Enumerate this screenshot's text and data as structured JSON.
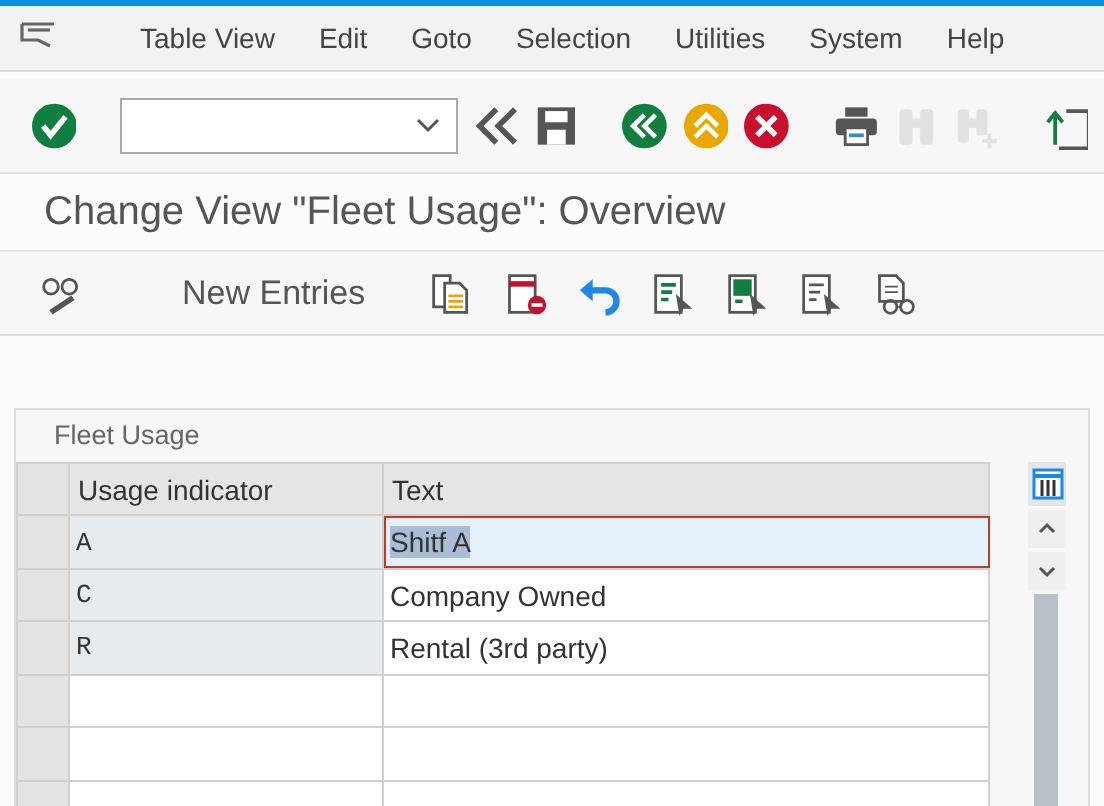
{
  "menu_bar": {
    "items": [
      "Table View",
      "Edit",
      "Goto",
      "Selection",
      "Utilities",
      "System",
      "Help"
    ]
  },
  "standard_toolbar": {
    "buttons": [
      {
        "kind": "collapse",
        "disabled": false
      },
      {
        "kind": "save",
        "disabled": false
      },
      {
        "kind": "back",
        "disabled": false
      },
      {
        "kind": "exit",
        "disabled": false
      },
      {
        "kind": "cancel",
        "disabled": false
      },
      {
        "kind": "print",
        "disabled": false
      },
      {
        "kind": "find",
        "disabled": true
      },
      {
        "kind": "find_next",
        "disabled": true
      },
      {
        "kind": "export",
        "disabled": false
      }
    ]
  },
  "title": "Change View \"Fleet Usage\": Overview",
  "application_toolbar": {
    "new_entries": "New Entries",
    "buttons": [
      {
        "kind": "copy"
      },
      {
        "kind": "delete"
      },
      {
        "kind": "undo"
      },
      {
        "kind": "select_all"
      },
      {
        "kind": "select_block"
      },
      {
        "kind": "deselect_all"
      },
      {
        "kind": "print_view"
      }
    ]
  },
  "group": {
    "title": "Fleet Usage",
    "table": {
      "columns": [
        "Usage indicator",
        "Text"
      ],
      "rows": [
        {
          "usage_indicator": "A",
          "text": "Shitf A",
          "selected": true
        },
        {
          "usage_indicator": "C",
          "text": "Company Owned",
          "selected": false
        },
        {
          "usage_indicator": "R",
          "text": "Rental (3rd party)",
          "selected": false
        }
      ]
    }
  }
}
